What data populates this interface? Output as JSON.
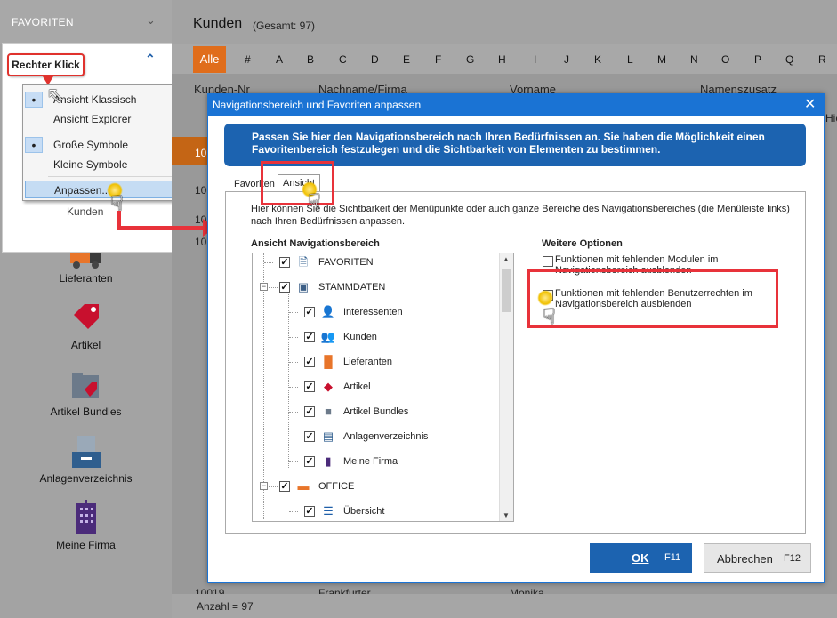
{
  "sidebar": {
    "favorites_title": "FAVORITEN",
    "callout": "Rechter Klick",
    "context_menu": [
      {
        "label": "Ansicht Klassisch",
        "selected": true
      },
      {
        "label": "Ansicht Explorer",
        "selected": false
      },
      {
        "label": "Große Symbole",
        "selected": true
      },
      {
        "label": "Kleine Symbole",
        "selected": false
      },
      {
        "label": "Anpassen...",
        "selected": false
      }
    ],
    "favorite_item": "Kunden",
    "nav_items": [
      "Lieferanten",
      "Artikel",
      "Artikel Bundles",
      "Anlagenverzeichnis",
      "Meine Firma"
    ]
  },
  "main": {
    "title": "Kunden",
    "subtitle": "(Gesamt: 97)",
    "alpha_all": "Alle",
    "alpha": [
      "#",
      "A",
      "B",
      "C",
      "D",
      "E",
      "F",
      "G",
      "H",
      "I",
      "J",
      "K",
      "L",
      "M",
      "N",
      "O",
      "P",
      "Q",
      "R"
    ],
    "columns": [
      "Kunden-Nr",
      "Nachname/Firma",
      "Vorname",
      "Namenszusatz"
    ],
    "row_partials": [
      "10",
      "10",
      "10",
      "10"
    ],
    "last_row": {
      "nr": "10019",
      "name": "Frankfurter",
      "vorname": "Monika"
    },
    "status": "Anzahl = 97",
    "right_partial": "Hie"
  },
  "dialog": {
    "title": "Navigationsbereich und Favoriten anpassen",
    "close": "✕",
    "banner": "Passen Sie hier den Navigationsbereich nach Ihren Bedürfnissen an. Sie haben die Möglichkeit einen Favoritenbereich festzulegen und die Sichtbarkeit von Elementen zu bestimmen.",
    "tabs": [
      "Favoriten",
      "Ansicht"
    ],
    "intro": "Hier können Sie die Sichtbarkeit der Menüpunkte oder auch ganze Bereiche des Navigationsbereiches (die Menüleiste links) nach Ihren Bedürfnissen anpassen.",
    "nav_heading": "Ansicht Navigationsbereich",
    "options_heading": "Weitere Optionen",
    "tree": [
      {
        "label": "FAVORITEN",
        "level": 0
      },
      {
        "label": "STAMMDATEN",
        "level": 0
      },
      {
        "label": "Interessenten",
        "level": 1
      },
      {
        "label": "Kunden",
        "level": 1
      },
      {
        "label": "Lieferanten",
        "level": 1
      },
      {
        "label": "Artikel",
        "level": 1
      },
      {
        "label": "Artikel Bundles",
        "level": 1
      },
      {
        "label": "Anlagenverzeichnis",
        "level": 1
      },
      {
        "label": "Meine Firma",
        "level": 1
      },
      {
        "label": "OFFICE",
        "level": 0
      },
      {
        "label": "Übersicht",
        "level": 1
      }
    ],
    "options": [
      "Funktionen mit fehlenden Modulen im Navigationsbereich ausblenden",
      "Funktionen mit fehlenden Benutzerrechten im Navigationsbereich ausblenden"
    ],
    "ok_label": "OK",
    "ok_key": "F11",
    "cancel_label": "Abbrechen",
    "cancel_key": "F12"
  }
}
